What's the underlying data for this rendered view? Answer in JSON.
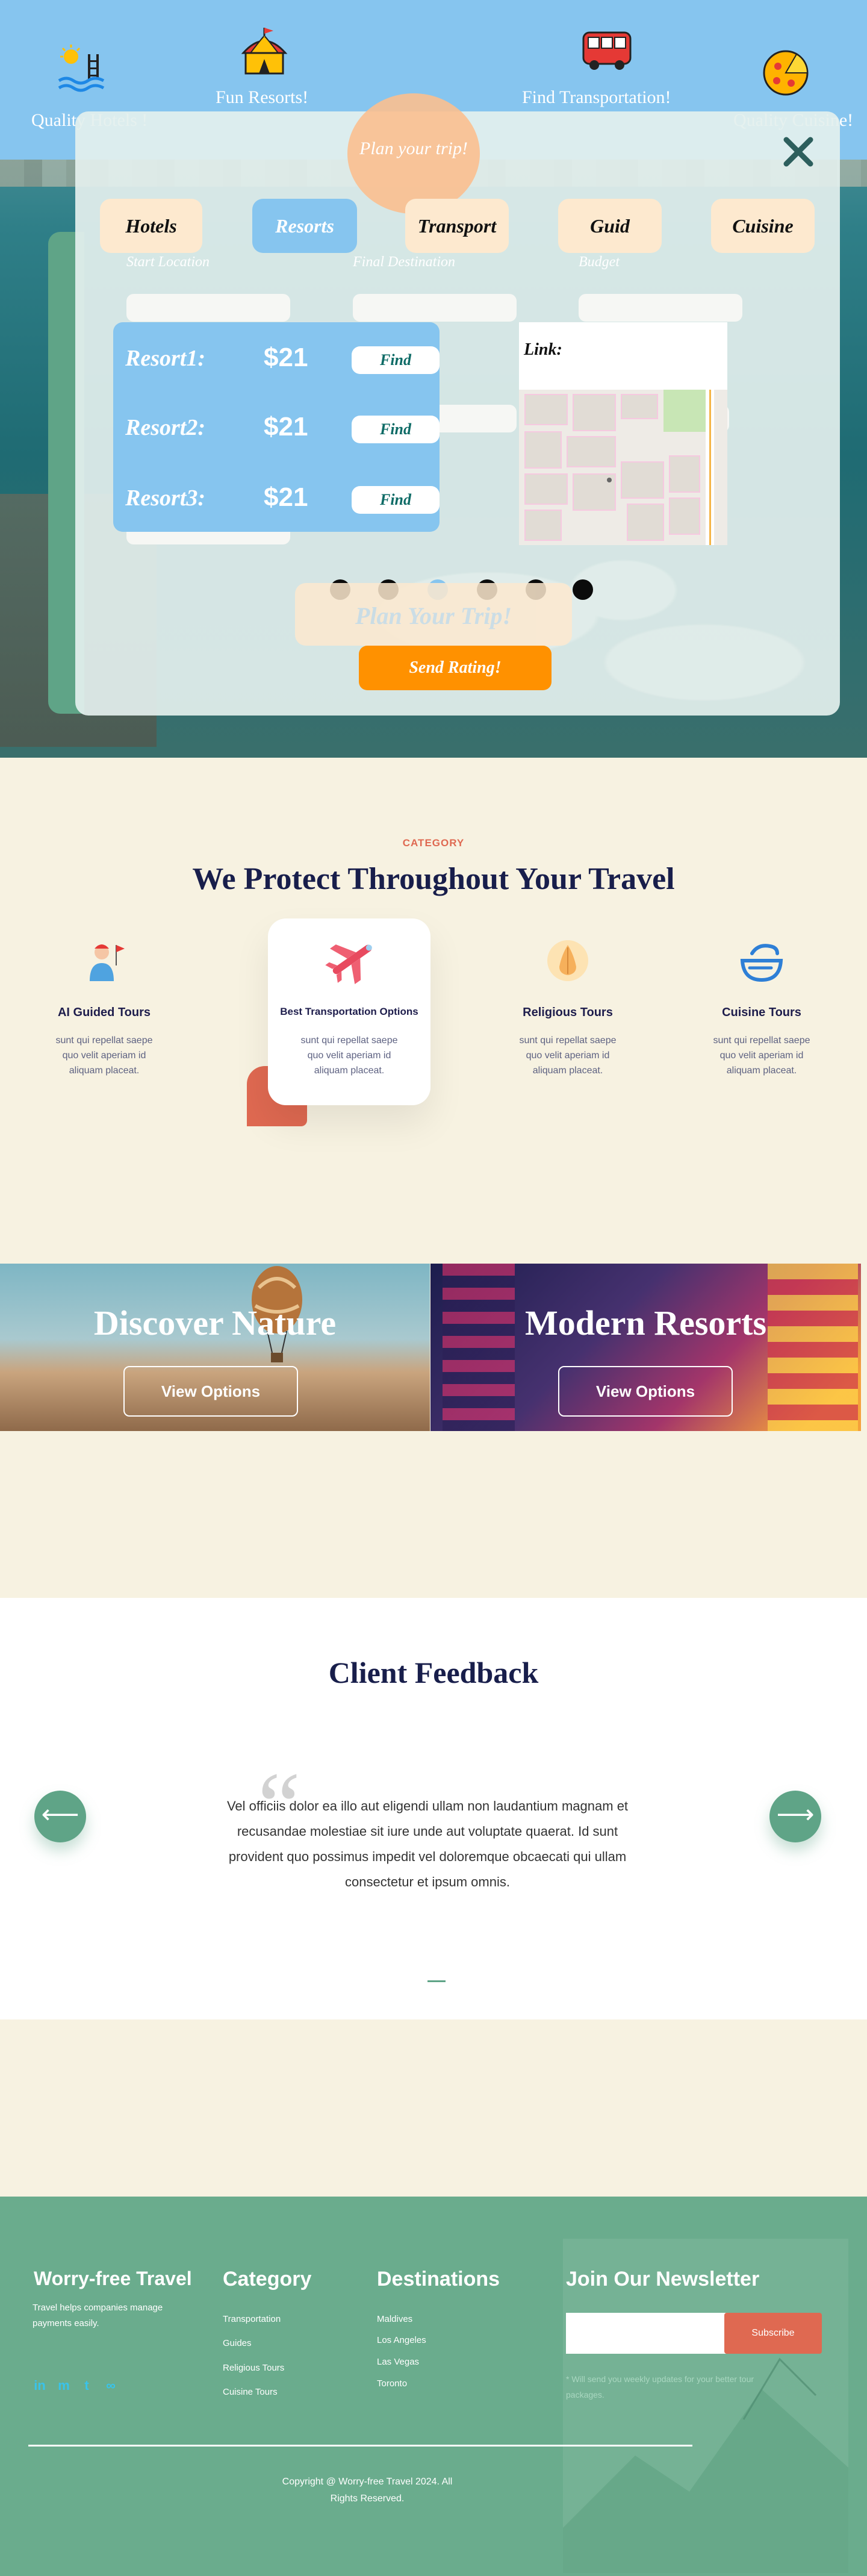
{
  "topbar": {
    "items": [
      {
        "label": "Quality Hotels !",
        "icon": "hotel-pool-icon"
      },
      {
        "label": "Fun Resorts!",
        "icon": "tent-icon"
      },
      {
        "label": "Find Transportation!",
        "icon": "bus-icon"
      },
      {
        "label": "Quality Cuisine!",
        "icon": "pizza-icon"
      }
    ]
  },
  "modal": {
    "title": "Plan your trip!",
    "tabs": [
      "Hotels",
      "Resorts",
      "Transport",
      "Guid",
      "Cuisine"
    ],
    "active_tab": "Resorts",
    "field_labels": [
      "Start Location",
      "Final Destination",
      "Budget"
    ],
    "resorts": [
      {
        "name": "Resort1:",
        "price": "$21",
        "action": "Find"
      },
      {
        "name": "Resort2:",
        "price": "$21",
        "action": "Find"
      },
      {
        "name": "Resort3:",
        "price": "$21",
        "action": "Find"
      }
    ],
    "map_label": "Link:",
    "plan_button": "Plan Your Trip!",
    "rate_button": "Send Rating!",
    "dots_count": 6,
    "active_dot": 2
  },
  "category": {
    "eyebrow": "CATEGORY",
    "title": "We Protect Throughout Your Travel",
    "items": [
      {
        "name": "AI Guided Tours",
        "desc": "sunt qui repellat saepe quo velit aperiam id aliquam placeat.",
        "icon": "guide-person-icon"
      },
      {
        "name": "Best Transportation Options",
        "desc": "sunt qui repellat saepe quo velit aperiam id aliquam placeat.",
        "icon": "airplane-icon"
      },
      {
        "name": "Religious Tours",
        "desc": "sunt qui repellat saepe quo velit aperiam id aliquam placeat.",
        "icon": "praying-hands-icon"
      },
      {
        "name": "Cuisine Tours",
        "desc": "sunt qui repellat saepe quo velit aperiam id aliquam placeat.",
        "icon": "cuisine-bowl-icon"
      }
    ]
  },
  "promos": [
    {
      "title": "Discover Nature",
      "button": "View Options"
    },
    {
      "title": "Modern Resorts",
      "button": "View Options"
    }
  ],
  "feedback": {
    "title": "Client Feedback",
    "quote": "Vel officiis dolor ea illo aut eligendi ullam non laudantium magnam et recusandae molestiae sit iure unde aut voluptate quaerat. Id sunt provident quo possimus impedit vel doloremque obcaecati qui ullam consectetur et ipsum omnis.",
    "prev_arrow": "⟵",
    "next_arrow": "⟶"
  },
  "footer": {
    "brand": "Worry-free Travel",
    "tagline": "Travel helps companies manage payments easily.",
    "social": [
      "in",
      "m",
      "t",
      "∞"
    ],
    "category_head": "Category",
    "category_links": [
      "Transportation",
      "Guides",
      "Religious Tours",
      "Cuisine Tours"
    ],
    "destinations_head": "Destinations",
    "destinations_links": [
      "Maldives",
      "Los Angeles",
      "Las Vegas",
      "Toronto"
    ],
    "newsletter_head": "Join Our Newsletter",
    "subscribe_label": "Subscribe",
    "newsletter_note": "* Will send you weekly updates for your better tour packages.",
    "copyright": "Copyright @ Worry-free Travel 2024. All Rights Reserved."
  },
  "colors": {
    "sky_blue": "#86c5ef",
    "navy": "#181e4b",
    "coral": "#df6951",
    "green": "#5fa487",
    "orange": "#ff9100",
    "cream": "#f7f2e1"
  }
}
